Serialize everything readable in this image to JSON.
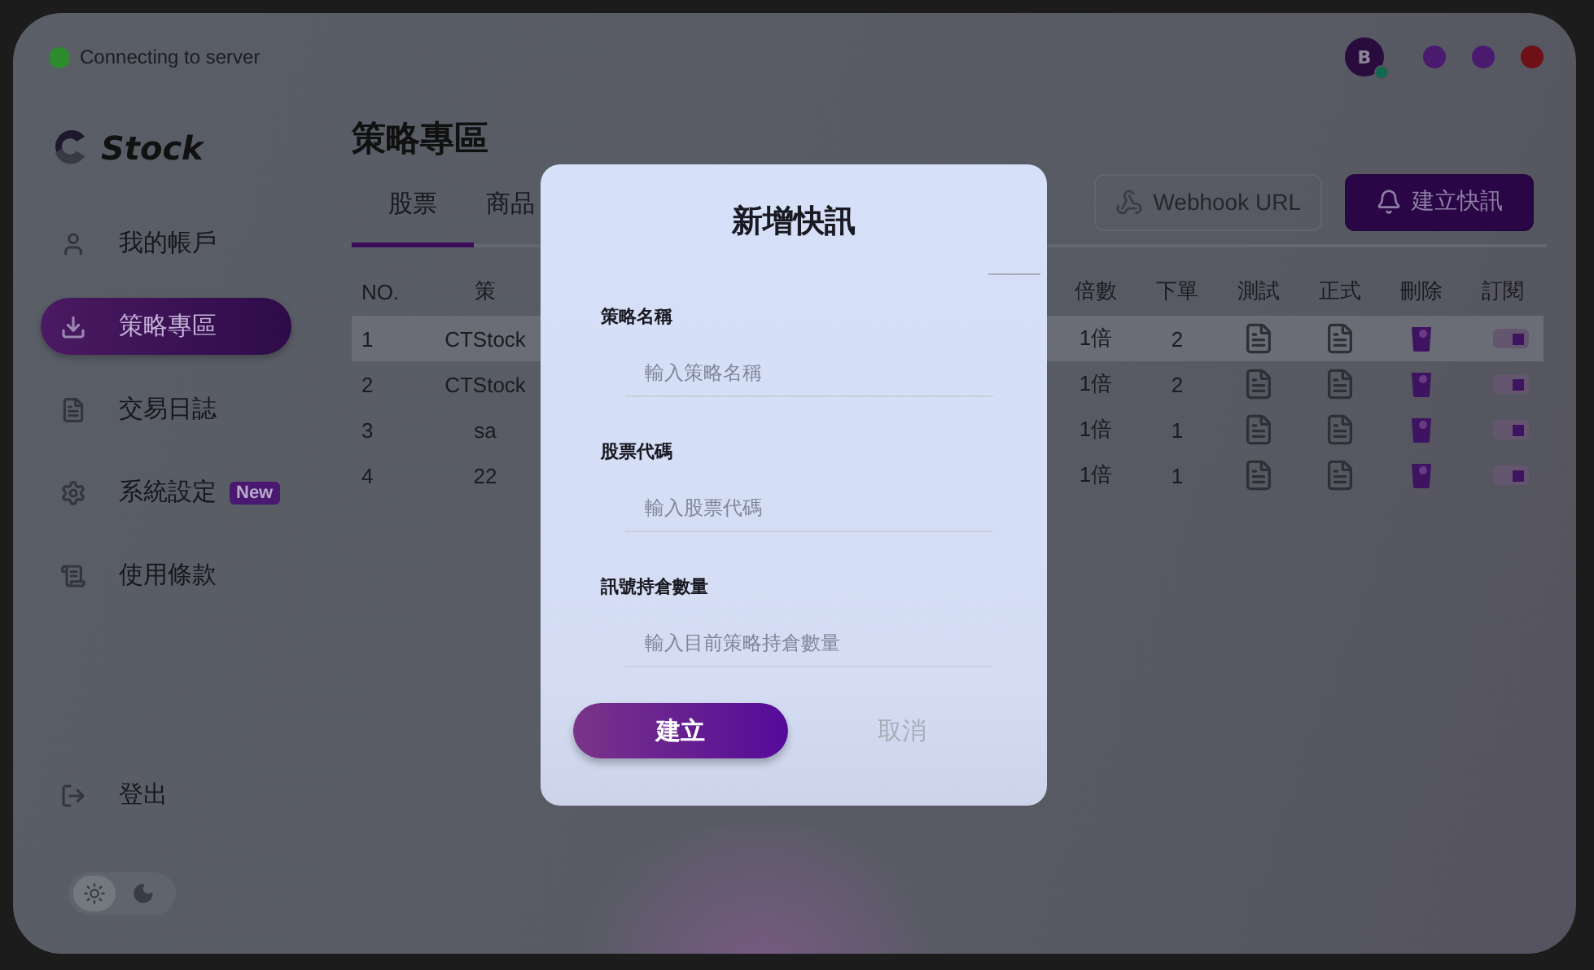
{
  "status": {
    "label": "Connecting to server",
    "online": true
  },
  "avatar": {
    "initial": "B",
    "online": true
  },
  "window_controls": [
    {
      "color": "#4a1a6e"
    },
    {
      "color": "#4a1a6e"
    },
    {
      "color": "#6e1016"
    }
  ],
  "logo": {
    "text": "Stock"
  },
  "sidebar": {
    "items": [
      {
        "label": "我的帳戶",
        "selected": false
      },
      {
        "label": "策略專區",
        "selected": true
      },
      {
        "label": "交易日誌",
        "selected": false
      },
      {
        "label": "系統設定",
        "selected": false,
        "badge": "New"
      },
      {
        "label": "使用條款",
        "selected": false
      }
    ]
  },
  "logout": {
    "label": "登出"
  },
  "theme_toggle": [
    {
      "kind": "light",
      "selected": true
    },
    {
      "kind": "dark",
      "selected": false
    }
  ],
  "page": {
    "title": "策略專區"
  },
  "tabs": [
    {
      "label": "股票",
      "selected": true
    },
    {
      "label": "商品",
      "selected": false
    }
  ],
  "actions": [
    {
      "label": "Webhook URL",
      "kind": "outline"
    },
    {
      "label": "建立快訊",
      "kind": "primary"
    }
  ],
  "table": {
    "columns": [
      "NO.",
      "策",
      "倍數",
      "下單",
      "測試",
      "正式",
      "刪除",
      "訂閱"
    ],
    "rows": [
      {
        "no": "1",
        "name": "CTStock",
        "multiplier": "1倍",
        "orders": "2",
        "selected": true,
        "subscribed": true
      },
      {
        "no": "2",
        "name": "CTStock",
        "multiplier": "1倍",
        "orders": "2",
        "selected": false,
        "subscribed": true
      },
      {
        "no": "3",
        "name": "sa",
        "multiplier": "1倍",
        "orders": "1",
        "selected": false,
        "subscribed": true
      },
      {
        "no": "4",
        "name": "22",
        "multiplier": "1倍",
        "orders": "1",
        "selected": false,
        "subscribed": true
      }
    ]
  },
  "dialog": {
    "title": "新增快訊",
    "fields": [
      {
        "label": "策略名稱",
        "placeholder": "輸入策略名稱"
      },
      {
        "label": "股票代碼",
        "placeholder": "輸入股票代碼"
      },
      {
        "label": "訊號持倉數量",
        "placeholder": "輸入目前策略持倉數量"
      }
    ],
    "buttons": [
      {
        "label": "建立",
        "kind": "primary"
      },
      {
        "label": "取消",
        "kind": "cancel"
      }
    ]
  }
}
